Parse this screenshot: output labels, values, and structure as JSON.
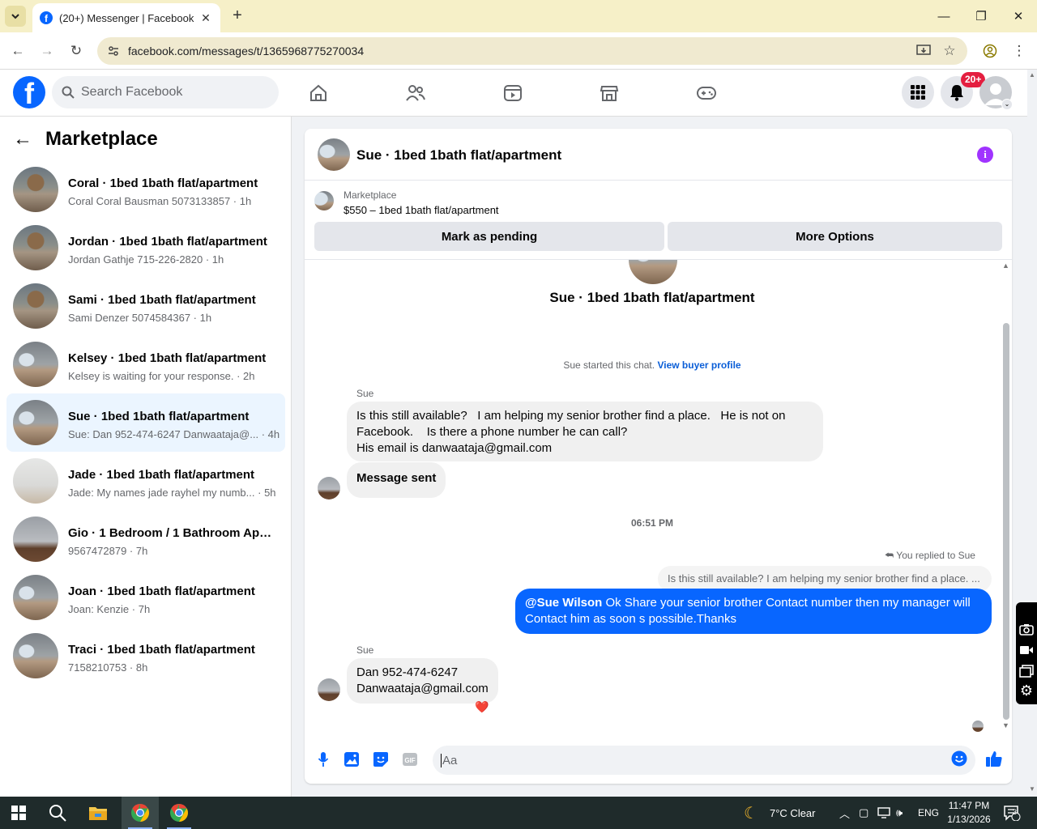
{
  "browser": {
    "tab_title": "(20+) Messenger | Facebook",
    "url": "facebook.com/messages/t/1365968775270034"
  },
  "header": {
    "search_placeholder": "Search Facebook",
    "notification_badge": "20+"
  },
  "sidebar": {
    "title": "Marketplace",
    "conversations": [
      {
        "name": "Coral · 1bed 1bath flat/apartment",
        "snippet": "Coral Coral Bausman 5073133857",
        "time": "1h",
        "thumb": "room-a"
      },
      {
        "name": "Jordan · 1bed 1bath flat/apartment",
        "snippet": "Jordan Gathje 715-226-2820",
        "time": "1h",
        "thumb": "room-a"
      },
      {
        "name": "Sami · 1bed 1bath flat/apartment",
        "snippet": "Sami Denzer 5074584367",
        "time": "1h",
        "thumb": "room-a"
      },
      {
        "name": "Kelsey · 1bed 1bath flat/apartment",
        "snippet": "Kelsey is waiting for your response.",
        "time": "2h",
        "thumb": "room-b"
      },
      {
        "name": "Sue · 1bed 1bath flat/apartment",
        "snippet": "Sue: Dan 952-474-6247 Danwaataja@...",
        "time": "4h",
        "thumb": "room-b",
        "active": true
      },
      {
        "name": "Jade · 1bed 1bath flat/apartment",
        "snippet": "Jade: My names jade rayhel my numb...",
        "time": "5h",
        "thumb": "room-c"
      },
      {
        "name": "Gio · 1 Bedroom / 1 Bathroom Apa...",
        "snippet": "9567472879",
        "time": "7h",
        "thumb": "room-d"
      },
      {
        "name": "Joan · 1bed 1bath flat/apartment",
        "snippet": "Joan: Kenzie",
        "time": "7h",
        "thumb": "room-b"
      },
      {
        "name": "Traci · 1bed 1bath flat/apartment",
        "snippet": "7158210753",
        "time": "8h",
        "thumb": "room-b"
      }
    ]
  },
  "chat": {
    "title": "Sue · 1bed 1bath flat/apartment",
    "marketplace_label": "Marketplace",
    "listing": "$550 – 1bed 1bath flat/apartment",
    "mark_pending_label": "Mark as pending",
    "more_options_label": "More Options",
    "profile_name": "Sue · 1bed 1bath flat/apartment",
    "started_text": "Sue started this chat.",
    "view_buyer_profile": "View buyer profile",
    "msg1_sender": "Sue",
    "msg1_line1": "Is this still available?   I am helping my senior brother find a place.   He is not on",
    "msg1_line2": "Facebook.    Is there a phone number he can call?",
    "msg1_line3": "His email is danwaataja@gmail.com",
    "msg2": "Message sent",
    "timestamp": "06:51 PM",
    "replied_label": "You replied to Sue",
    "quoted": "Is this still available?   I am helping my senior brother find a place. ...",
    "reply_mention": "@Sue Wilson",
    "reply_line1": " Ok Share your senior brother Contact number then my manager will",
    "reply_line2": "Contact him as soon s possible.Thanks",
    "msg3_sender": "Sue",
    "msg3_line1": "Dan 952-474-6247",
    "msg3_line2": "Danwaataja@gmail.com",
    "reaction": "❤️",
    "composer_placeholder": "Aa"
  },
  "taskbar": {
    "weather": "7°C  Clear",
    "language": "ENG",
    "time": "11:47 PM",
    "date": "1/13/2026",
    "notifications_count": "3"
  },
  "colors": {
    "fb_blue": "#0866ff",
    "active_row": "#ebf5ff",
    "badge_red": "#e41e3f",
    "info_purple": "#a033ff"
  }
}
